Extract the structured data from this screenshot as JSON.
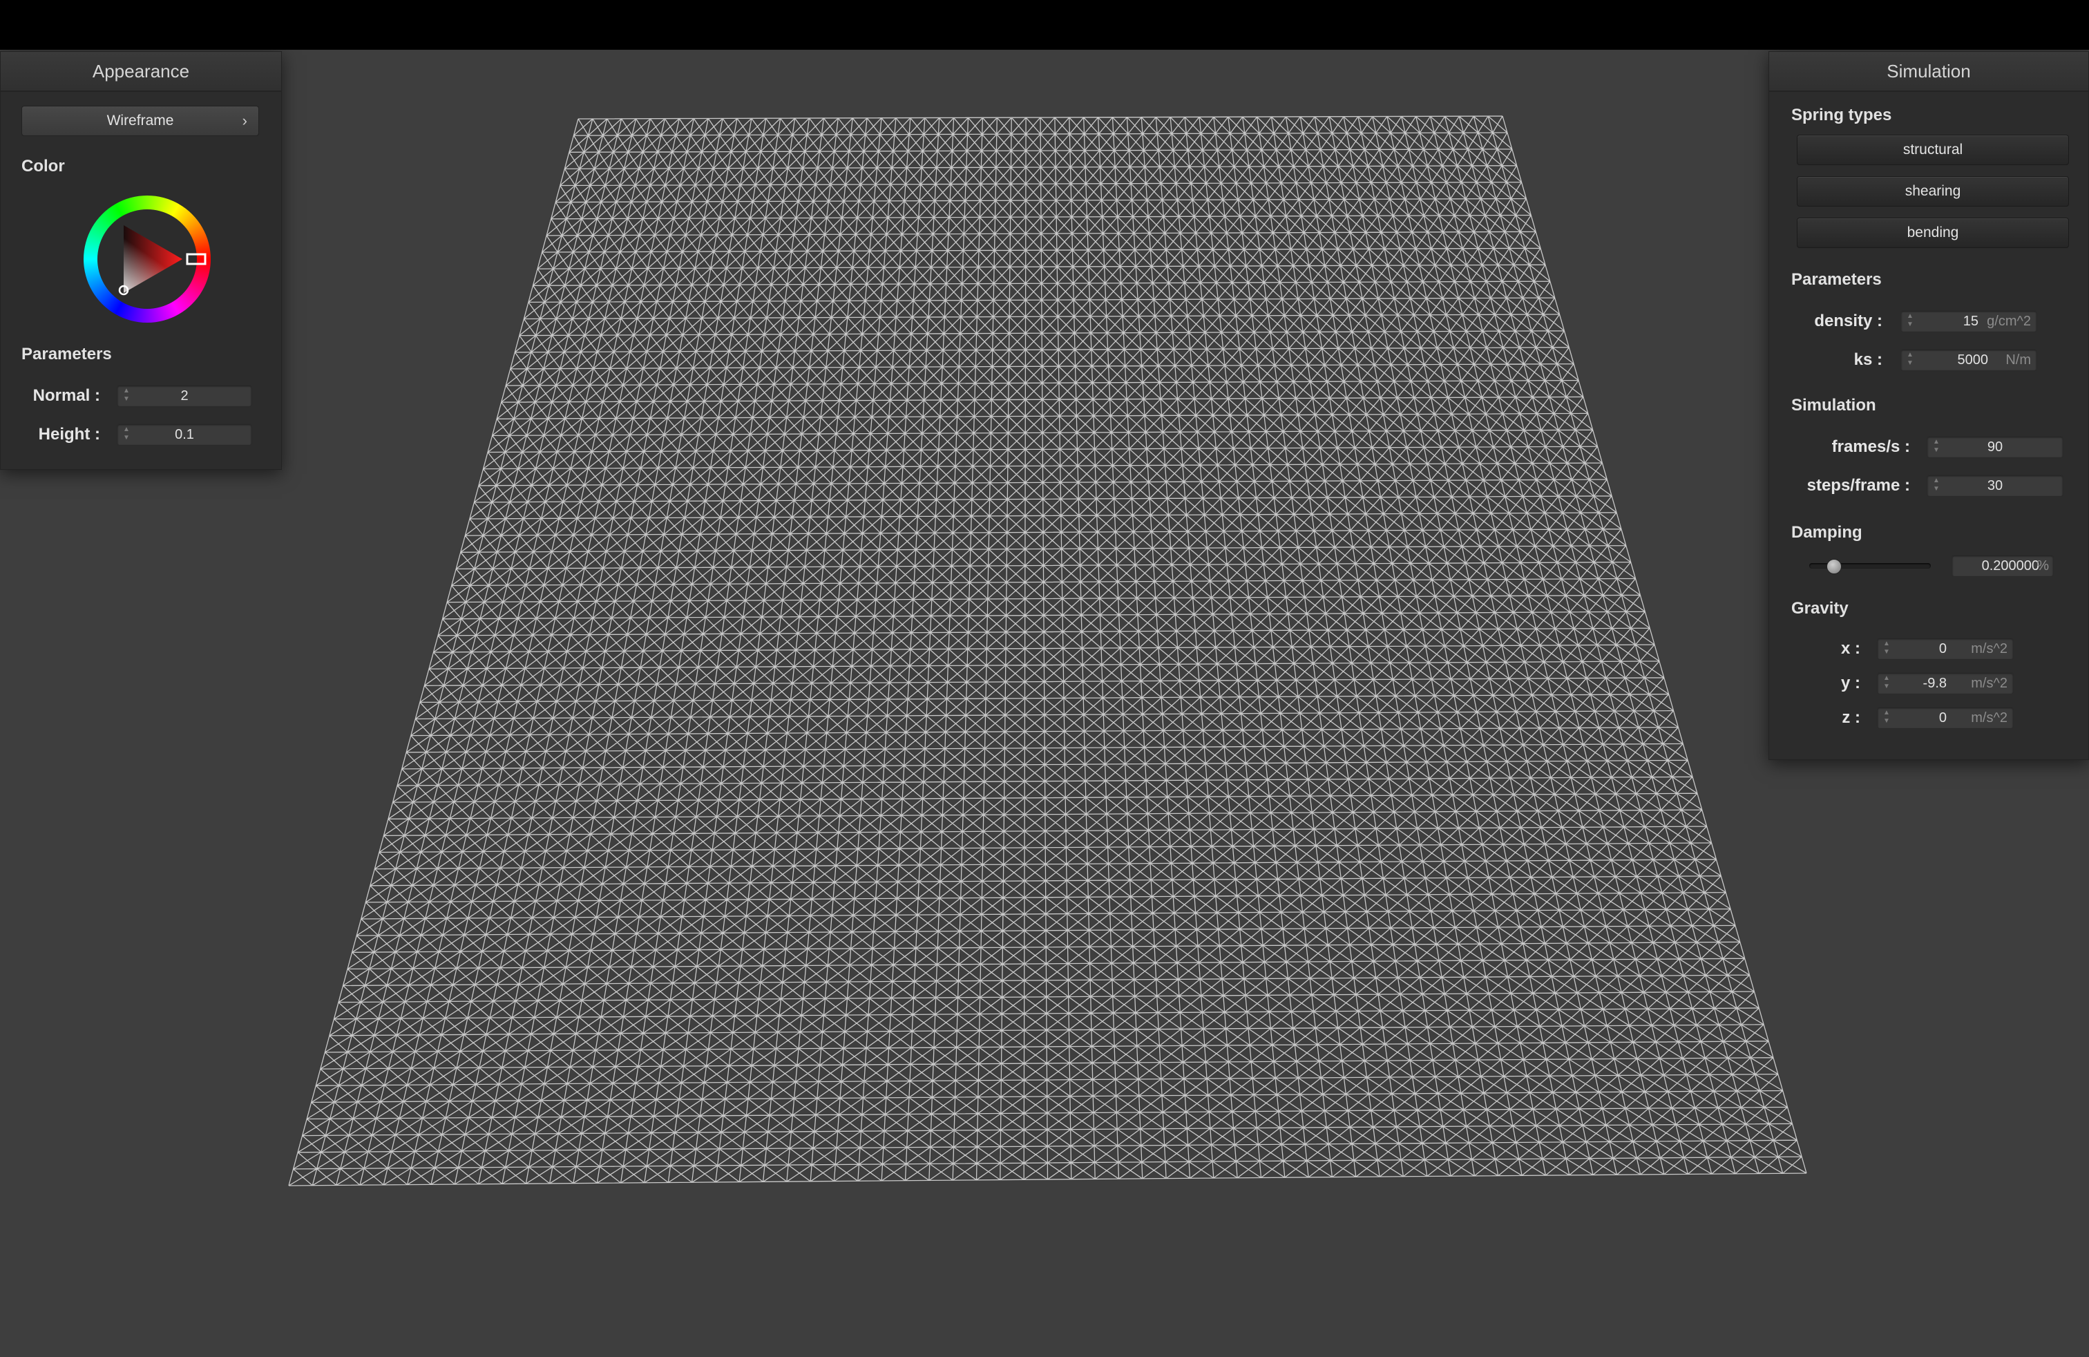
{
  "appearance": {
    "title": "Appearance",
    "mode_label": "Wireframe",
    "color_label": "Color",
    "parameters_label": "Parameters",
    "normal_label": "Normal :",
    "normal_value": "2",
    "height_label": "Height :",
    "height_value": "0.1",
    "color_value": "#ff0000"
  },
  "simulation": {
    "title": "Simulation",
    "spring_types_label": "Spring types",
    "spring_types": [
      "structural",
      "shearing",
      "bending"
    ],
    "parameters_label": "Parameters",
    "density_label": "density :",
    "density_value": "15",
    "density_unit": "g/cm^2",
    "ks_label": "ks :",
    "ks_value": "5000",
    "ks_unit": "N/m",
    "simulation_label": "Simulation",
    "fps_label": "frames/s :",
    "fps_value": "90",
    "steps_label": "steps/frame :",
    "steps_value": "30",
    "damping_label": "Damping",
    "damping_value": "0.200000",
    "damping_unit": "%",
    "damping_fraction": 0.2,
    "gravity_label": "Gravity",
    "gx_label": "x :",
    "gx_value": "0",
    "gy_label": "y :",
    "gy_value": "-9.8",
    "gz_label": "z :",
    "gz_value": "0",
    "gravity_unit": "m/s^2"
  },
  "scene": {
    "background_color": "#3e3e3e",
    "wire_color": "#ffffff",
    "grid_divisions": 64
  }
}
